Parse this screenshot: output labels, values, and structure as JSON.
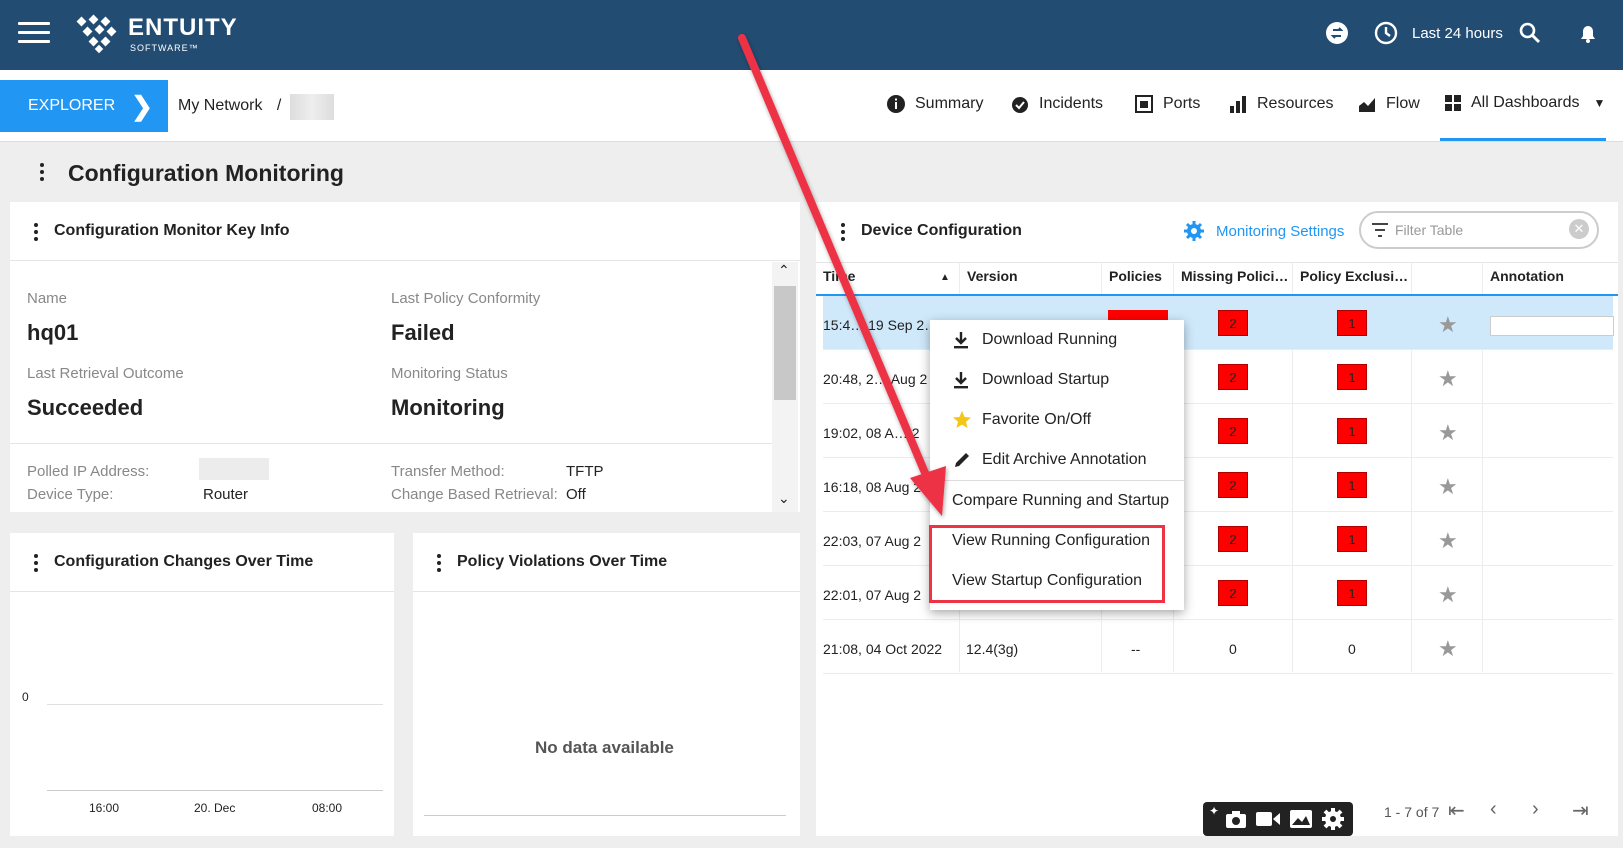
{
  "header": {
    "brand": "ENTUITY",
    "brand_sub": "SOFTWARE™",
    "time_range": "Last 24 hours"
  },
  "nav": {
    "explorer_label": "EXPLORER",
    "breadcrumb_root": "My Network",
    "breadcrumb_sep": "/",
    "items": [
      "Summary",
      "Incidents",
      "Ports",
      "Resources",
      "Flow",
      "All Dashboards"
    ]
  },
  "page": {
    "title": "Configuration Monitoring"
  },
  "key_info": {
    "title": "Configuration Monitor Key Info",
    "name_label": "Name",
    "name_value": "hq01",
    "conformity_label": "Last Policy Conformity",
    "conformity_value": "Failed",
    "retrieval_label": "Last Retrieval Outcome",
    "retrieval_value": "Succeeded",
    "status_label": "Monitoring Status",
    "status_value": "Monitoring",
    "polled_ip_label": "Polled IP Address:",
    "transfer_label": "Transfer Method:",
    "transfer_value": "TFTP",
    "device_type_label": "Device Type:",
    "device_type_value": "Router",
    "change_retrieval_label": "Change Based Retrieval:",
    "change_retrieval_value": "Off"
  },
  "changes_chart": {
    "title": "Configuration Changes Over Time",
    "y_tick": "0",
    "x_ticks": [
      "16:00",
      "20. Dec",
      "08:00"
    ]
  },
  "violations_chart": {
    "title": "Policy Violations Over Time",
    "empty": "No data available"
  },
  "device_config": {
    "title": "Device Configuration",
    "settings_label": "Monitoring Settings",
    "filter_placeholder": "Filter Table",
    "columns": [
      "Time",
      "Version",
      "Policies",
      "Missing Polici…",
      "Policy Exclusi…",
      "Annotation"
    ],
    "rows": [
      {
        "time": "15:4… 19 Sep 2…",
        "missing": "2",
        "excl": "1"
      },
      {
        "time": "20:48, 2… Aug 2",
        "missing": "2",
        "excl": "1"
      },
      {
        "time": "19:02, 08 A… 2",
        "missing": "2",
        "excl": "1"
      },
      {
        "time": "16:18, 08 Aug 2",
        "missing": "2",
        "excl": "1"
      },
      {
        "time": "22:03, 07 Aug 2",
        "missing": "2",
        "excl": "1"
      },
      {
        "time": "22:01, 07 Aug 2",
        "missing": "2",
        "excl": "1"
      },
      {
        "time": "21:08, 04 Oct 2022",
        "version": "12.4(3g)",
        "policies": "--",
        "missing": "0",
        "excl": "0"
      }
    ],
    "pagination": "1 - 7 of 7"
  },
  "context_menu": {
    "items": [
      "Download Running",
      "Download Startup",
      "Favorite On/Off",
      "Edit Archive Annotation",
      "Compare Running and Startup",
      "View Running Configuration",
      "View Startup Configuration"
    ]
  },
  "colors": {
    "header": "#234c73",
    "accent": "#2196f3",
    "annotation": "#ee3344",
    "badge": "#ff0000"
  }
}
